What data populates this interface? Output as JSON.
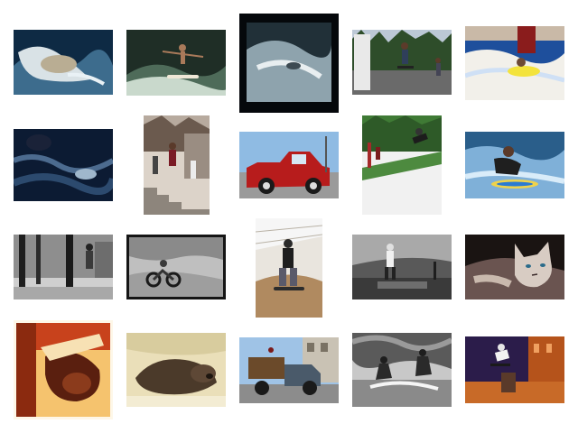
{
  "gallery": {
    "items": [
      {
        "id": "surf-crash",
        "accent": "#0e2a44",
        "alt": "#d9e2e6"
      },
      {
        "id": "surf-wave",
        "accent": "#2f4a3c",
        "alt": "#c9d9cc"
      },
      {
        "id": "river-surf",
        "accent": "#0b1116",
        "alt": "#8ea3ad"
      },
      {
        "id": "skate-jump",
        "accent": "#2e4d2a",
        "alt": "#bcc8d6"
      },
      {
        "id": "bodyboard",
        "accent": "#1e4f9c",
        "alt": "#f2f0ea"
      },
      {
        "id": "dark-water",
        "accent": "#0c1b33",
        "alt": "#4c6b8f"
      },
      {
        "id": "stairs-skate",
        "accent": "#6b5a4e",
        "alt": "#dcd3c9"
      },
      {
        "id": "red-truck",
        "accent": "#b71c1c",
        "alt": "#8fbbe3"
      },
      {
        "id": "ramp-trick",
        "accent": "#3f7a35",
        "alt": "#f1f1f1"
      },
      {
        "id": "surfer-board",
        "accent": "#2a5e8a",
        "alt": "#7fb0d8"
      },
      {
        "id": "bw-skate-trees",
        "accent": "#2b2b2b",
        "alt": "#cfcfcf"
      },
      {
        "id": "dirt-bike",
        "accent": "#3a3a3a",
        "alt": "#bfbfbf"
      },
      {
        "id": "skatepark-indoor",
        "accent": "#6d5945",
        "alt": "#e9e5de"
      },
      {
        "id": "street-skate-bw",
        "accent": "#3a3a3a",
        "alt": "#a9a9a9"
      },
      {
        "id": "cat",
        "accent": "#6a5450",
        "alt": "#1a1412"
      },
      {
        "id": "warm-portrait",
        "accent": "#8b2a0f",
        "alt": "#f5c36e"
      },
      {
        "id": "sleeping-bear",
        "accent": "#4b3a2a",
        "alt": "#eadfb9"
      },
      {
        "id": "old-truck",
        "accent": "#4a5a6a",
        "alt": "#9fc3e6"
      },
      {
        "id": "bw-splash-skate",
        "accent": "#1e1e1e",
        "alt": "#c8c8c8"
      },
      {
        "id": "night-skate",
        "accent": "#b5531b",
        "alt": "#2b1c4a"
      }
    ]
  }
}
